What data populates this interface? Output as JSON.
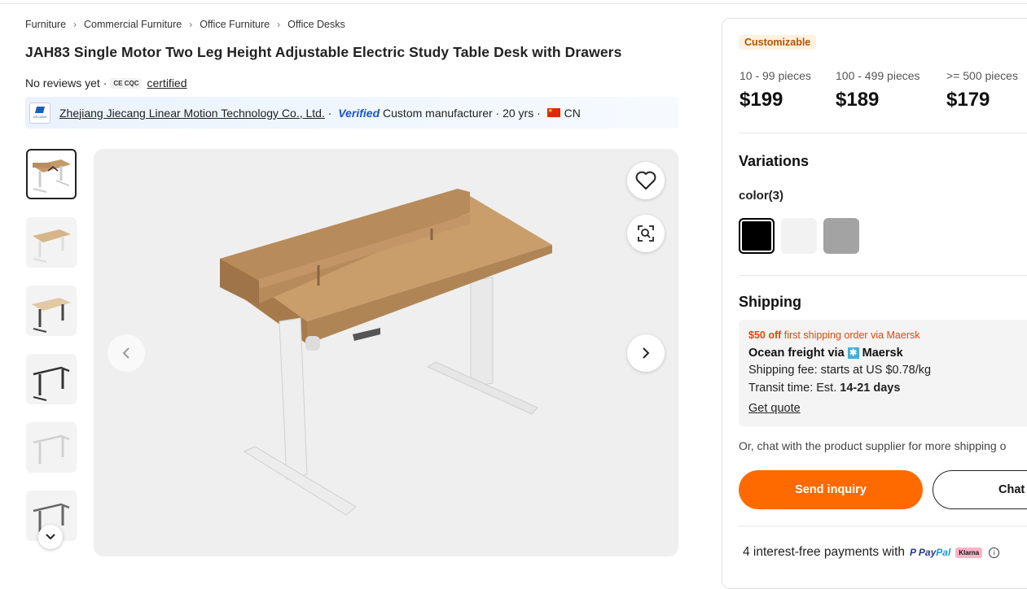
{
  "breadcrumb": [
    "Furniture",
    "Commercial Furniture",
    "Office Furniture",
    "Office Desks"
  ],
  "product": {
    "title": "JAH83 Single Motor Two Leg Height Adjustable Electric Study Table Desk with Drawers",
    "reviews": "No reviews yet ·",
    "cert_badge": "CE CQC",
    "cert_label": "certified"
  },
  "supplier": {
    "logo_text": "JIECANG",
    "name": "Zhejiang Jiecang Linear Motion Technology Co., Ltd.",
    "sep1": " · ",
    "verified": "Verified",
    "type": " Custom manufacturer · 20 yrs · ",
    "country": "CN"
  },
  "gallery": {
    "thumbnail_count": 6,
    "active_index": 0
  },
  "pricing": {
    "badge": "Customizable",
    "tiers": [
      {
        "qty": "10 - 99 pieces",
        "price": "$199"
      },
      {
        "qty": "100 - 499 pieces",
        "price": "$189"
      },
      {
        "qty": ">= 500 pieces",
        "price": "$179"
      }
    ]
  },
  "variations": {
    "title": "Variations",
    "color_label": "color(3)",
    "swatches": [
      "#000000",
      "#f2f2f2",
      "#a3a3a3"
    ]
  },
  "shipping": {
    "title": "Shipping",
    "promo_bold": "$50 off",
    "promo_rest": " first shipping order via Maersk",
    "method_prefix": "Ocean freight via",
    "carrier": "Maersk",
    "fee": "Shipping fee: starts at US $0.78/kg",
    "transit_prefix": "Transit time: Est. ",
    "transit_days": "14-21 days",
    "quote_link": "Get quote",
    "chat_note": "Or, chat with the product supplier for more shipping o"
  },
  "actions": {
    "inquiry": "Send inquiry",
    "chat": "Chat"
  },
  "payments": {
    "text": "4 interest-free payments with",
    "paypal_a": "Pay",
    "paypal_b": "Pal",
    "klarna": "Klarna"
  },
  "colors": {
    "accent": "#ff6a00",
    "verified": "#1a54d6",
    "promo": "#e4450f"
  }
}
